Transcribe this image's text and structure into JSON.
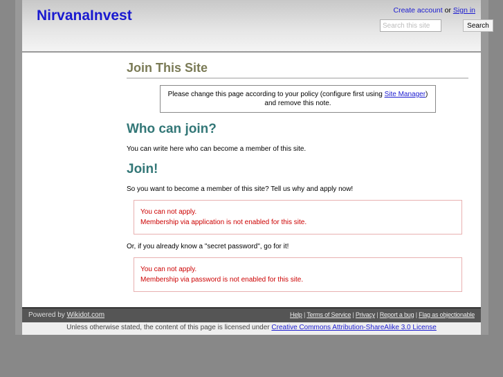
{
  "header": {
    "site_title": "NirvanaInvest",
    "create_account": "Create account",
    "or": "or",
    "sign_in": "Sign in",
    "search_placeholder": "Search this site",
    "search_button": "Search"
  },
  "main": {
    "title": "Join This Site",
    "note_pre": "Please change this page according to your policy (configure first using ",
    "note_link": "Site Manager",
    "note_post": ") and remove this note.",
    "who_heading": "Who can join?",
    "who_text": "You can write here who can become a member of this site.",
    "join_heading": "Join!",
    "join_text": "So you want to become a member of this site? Tell us why and apply now!",
    "error1": {
      "line1": "You can not apply.",
      "line2": "Membership via application is not enabled for this site."
    },
    "password_text": "Or, if you already know a \"secret password\", go for it!",
    "error2": {
      "line1": "You can not apply.",
      "line2": "Membership via password is not enabled for this site."
    }
  },
  "footer": {
    "powered_by": "Powered by ",
    "wikidot": "Wikidot.com",
    "links": [
      "Help",
      "Terms of Service",
      "Privacy",
      "Report a bug",
      "Flag as objectionable"
    ]
  },
  "license": {
    "text": "Unless otherwise stated, the content of this page is licensed under ",
    "link": "Creative Commons Attribution-ShareAlike 3.0 License"
  }
}
